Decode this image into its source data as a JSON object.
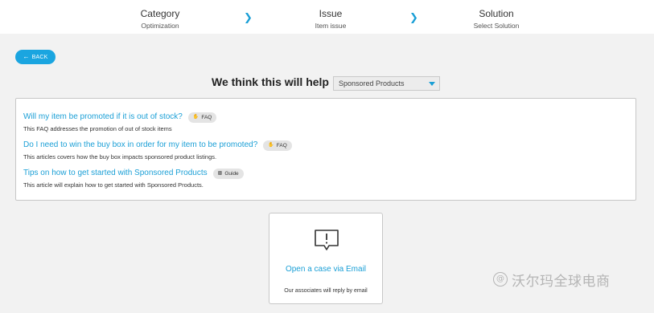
{
  "stepper": {
    "steps": [
      {
        "title": "Category",
        "subtitle": "Optimization"
      },
      {
        "title": "Issue",
        "subtitle": "Item issue"
      },
      {
        "title": "Solution",
        "subtitle": "Select Solution"
      }
    ]
  },
  "back_button": {
    "label": "BACK",
    "icon": "arrow-left-icon"
  },
  "help": {
    "heading": "We think this will help",
    "select_value": "Sponsored Products"
  },
  "faq_list": {
    "items": [
      {
        "title": "Will my item be promoted if it is out of stock?",
        "badge": "FAQ",
        "badge_icon": "thumbs-icon",
        "description": "This FAQ addresses the promotion of out of stock items"
      },
      {
        "title": "Do I need to win the buy box in order for my item to be promoted?",
        "badge": "FAQ",
        "badge_icon": "thumbs-icon",
        "description": "This articles covers how the buy box impacts sponsored product listings."
      },
      {
        "title": "Tips on how to get started with Sponsored Products",
        "badge": "Guide",
        "badge_icon": "guide-icon",
        "description": "This article will explain how to get started with Sponsored Products."
      }
    ]
  },
  "email_card": {
    "title": "Open a case via Email",
    "subtitle": "Our associates will reply by email",
    "icon": "alert-message-icon"
  },
  "watermark": {
    "text": "沃尔玛全球电商",
    "symbol": "@"
  },
  "colors": {
    "accent": "#1a9fd6",
    "button": "#1aa5e0",
    "background": "#f2f2f2",
    "badge": "#e4e4e4"
  }
}
